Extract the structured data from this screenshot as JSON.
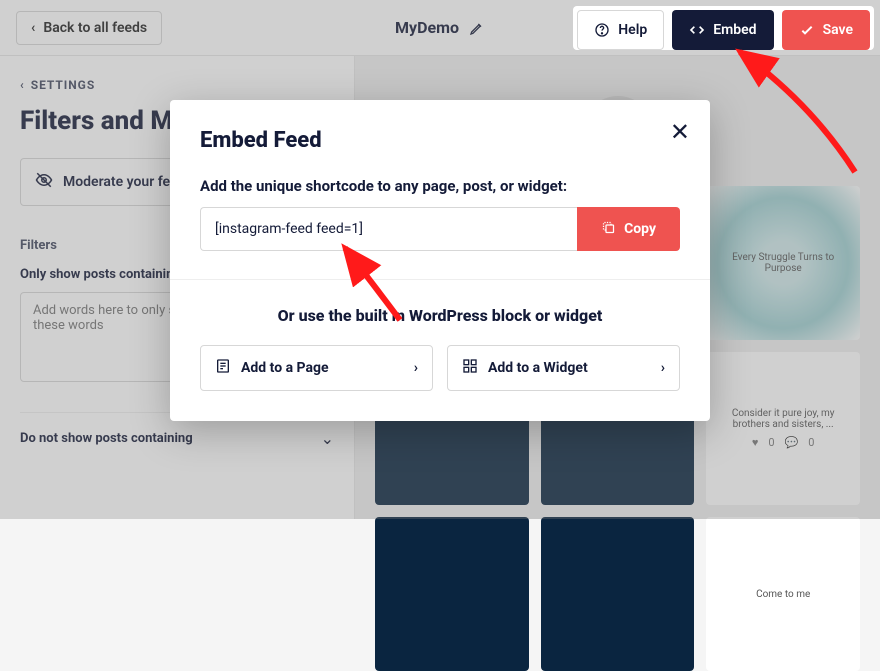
{
  "topbar": {
    "back_label": "Back to all feeds",
    "feed_name": "MyDemo",
    "help_label": "Help",
    "embed_label": "Embed",
    "save_label": "Save"
  },
  "sidebar": {
    "settings_label": "SETTINGS",
    "panel_title": "Filters and Moderation",
    "moderate_label": "Moderate your feed",
    "filters_heading": "Filters",
    "only_show_label": "Only show posts containing",
    "only_show_placeholder": "Add words here to only show posts containing these words",
    "do_not_show_label": "Do not show posts containing"
  },
  "preview": {
    "tiles": [
      {
        "text": "",
        "cls": "dark"
      },
      {
        "text": "",
        "cls": "dark"
      },
      {
        "text": "Every Struggle Turns to Purpose",
        "cls": "teal"
      },
      {
        "text": "",
        "cls": "dark"
      },
      {
        "text": "",
        "cls": "dark"
      },
      {
        "text": "Consider it pure joy, my brothers and sisters, ...",
        "cls": "",
        "hasFooter": true,
        "likes": "0",
        "comments": "0"
      },
      {
        "text": "",
        "cls": "dark"
      },
      {
        "text": "",
        "cls": "dark"
      },
      {
        "text": "Come to me",
        "cls": ""
      }
    ]
  },
  "modal": {
    "title": "Embed Feed",
    "instruction": "Add the unique shortcode to any page, post, or widget:",
    "shortcode": "[instagram-feed feed=1]",
    "copy_label": "Copy",
    "or_label": "Or use the built in WordPress block or widget",
    "add_page_label": "Add to a Page",
    "add_widget_label": "Add to a Widget"
  }
}
